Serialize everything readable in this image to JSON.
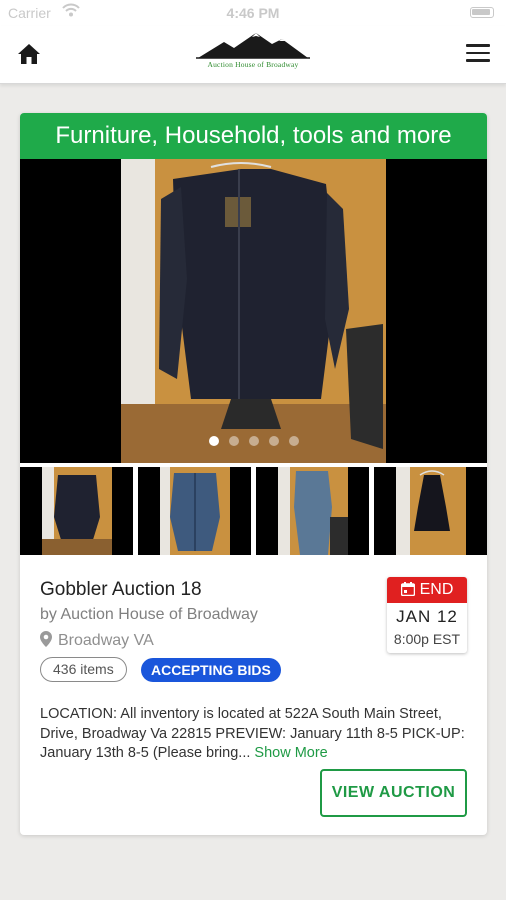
{
  "status_bar": {
    "carrier": "Carrier",
    "time": "4:46 PM"
  },
  "header": {
    "logo_text": "Auction House of Broadway",
    "icons": [
      "home-icon",
      "hamburger-menu-icon",
      "mountain-logo"
    ]
  },
  "card": {
    "title": "Furniture, Household, tools and more",
    "carousel": {
      "slides": 5,
      "active_slide": 1
    },
    "thumbnails": [
      "leather-jacket-thumb",
      "denim-jacket-thumb",
      "denim-coat-thumb",
      "dark-dress-thumb"
    ],
    "auction_name": "Gobbler Auction 18",
    "by_line": "by Auction House of Broadway",
    "location": "Broadway VA",
    "items_count": "436 items",
    "status": "ACCEPTING BIDS",
    "end": {
      "label": "END",
      "date": "JAN 12",
      "time": "8:00p EST"
    },
    "description": "LOCATION: All inventory is located at 522A South Main Street, Drive, Broadway Va 22815 PREVIEW: January 11th 8-5 PICK-UP: January 13th 8-5 (Please bring...",
    "show_more": "Show More",
    "view_button": "VIEW AUCTION"
  },
  "colors": {
    "accent_green": "#1faa4a",
    "end_red": "#e02020",
    "status_blue": "#1a56db"
  }
}
